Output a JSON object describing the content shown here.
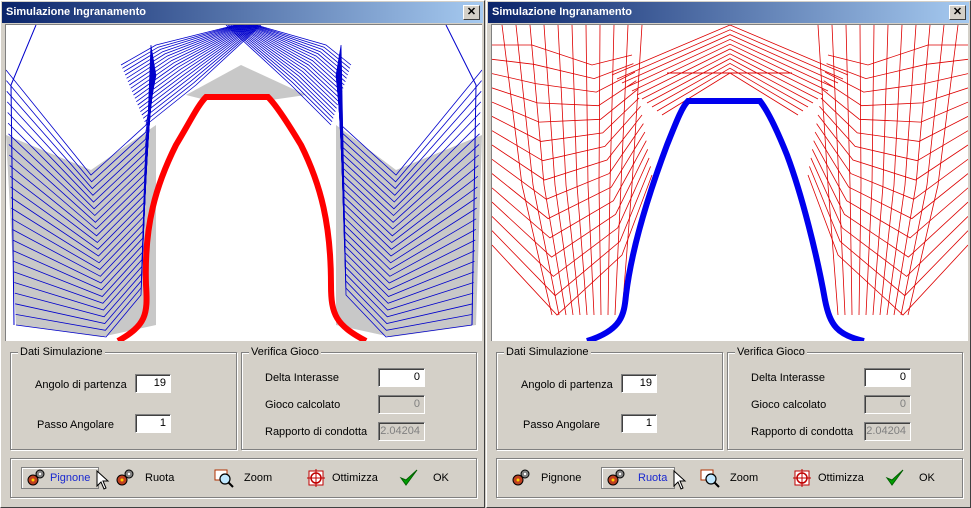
{
  "windows": [
    {
      "title": "Simulazione Ingranamento",
      "close_glyph": "✕",
      "mesh_color": "#0000cc",
      "tooth_color": "#ff0000",
      "sim": {
        "group_label": "Dati Simulazione",
        "start_angle_label": "Angolo di partenza",
        "start_angle": "19",
        "step_label": "Passo Angolare",
        "step": "1"
      },
      "backlash": {
        "group_label": "Verifica Gioco",
        "delta_label": "Delta Interasse",
        "delta": "0",
        "gioco_label": "Gioco calcolato",
        "gioco": "0",
        "ratio_label": "Rapporto di condotta",
        "ratio": "2.04204"
      },
      "toolbar": {
        "active": "pignone",
        "pignone": "Pignone",
        "ruota": "Ruota",
        "zoom": "Zoom",
        "ottimizza": "Ottimizza",
        "ok": "OK"
      }
    },
    {
      "title": "Simulazione Ingranamento",
      "close_glyph": "✕",
      "mesh_color": "#dd0000",
      "tooth_color": "#0000ee",
      "sim": {
        "group_label": "Dati Simulazione",
        "start_angle_label": "Angolo di partenza",
        "start_angle": "19",
        "step_label": "Passo Angolare",
        "step": "1"
      },
      "backlash": {
        "group_label": "Verifica Gioco",
        "delta_label": "Delta Interasse",
        "delta": "0",
        "gioco_label": "Gioco calcolato",
        "gioco": "0",
        "ratio_label": "Rapporto di condotta",
        "ratio": "2.04204"
      },
      "toolbar": {
        "active": "ruota",
        "pignone": "Pignone",
        "ruota": "Ruota",
        "zoom": "Zoom",
        "ottimizza": "Ottimizza",
        "ok": "OK"
      }
    }
  ],
  "icons": {
    "pignone": "gears-icon",
    "ruota": "gears-icon",
    "zoom": "zoom-icon",
    "ottimizza": "optimize-icon",
    "ok": "checkmark-icon"
  }
}
